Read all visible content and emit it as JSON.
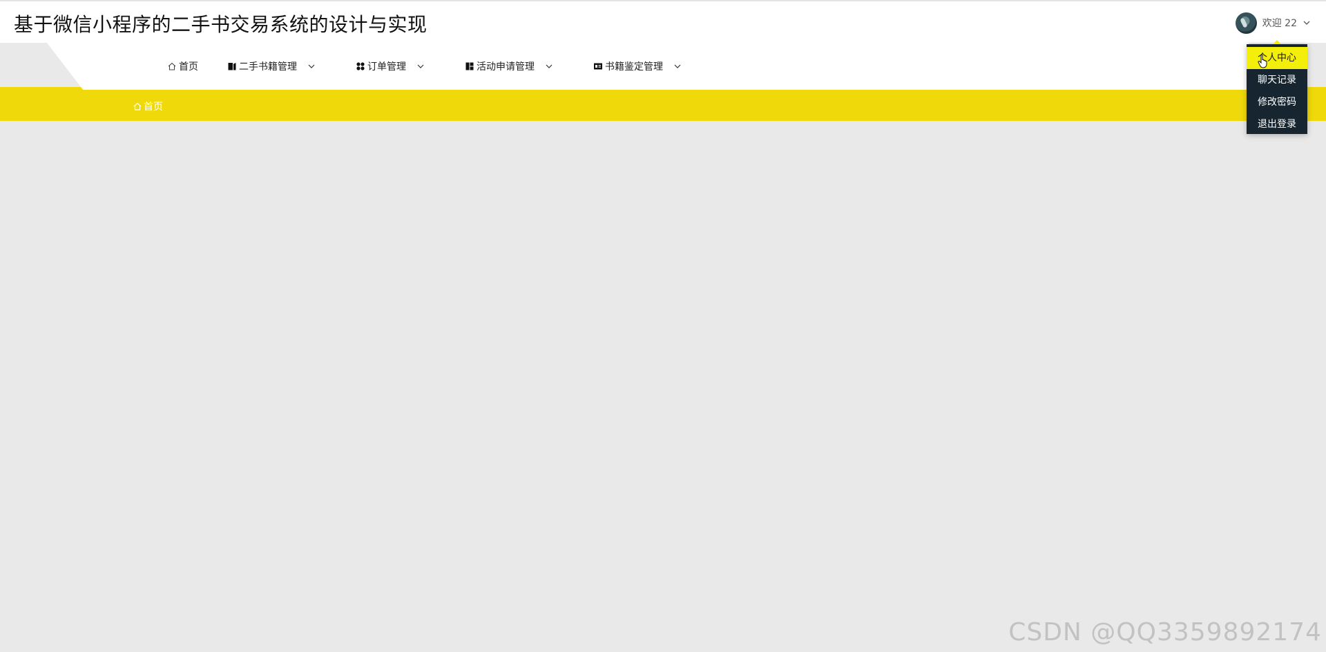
{
  "header": {
    "title": "基于微信小程序的二手书交易系统的设计与实现",
    "welcome": "欢迎 22"
  },
  "nav": {
    "items": [
      {
        "label": "首页",
        "icon": "home-icon"
      },
      {
        "label": "二手书籍管理",
        "icon": "book-icon"
      },
      {
        "label": "订单管理",
        "icon": "grid-icon"
      },
      {
        "label": "活动申请管理",
        "icon": "layout-icon"
      },
      {
        "label": "书籍鉴定管理",
        "icon": "id-card-icon"
      }
    ]
  },
  "breadcrumb": {
    "label": "首页",
    "icon": "home-icon"
  },
  "user_menu": {
    "items": [
      {
        "label": "个人中心",
        "state": "hovered"
      },
      {
        "label": "聊天记录"
      },
      {
        "label": "修改密码"
      },
      {
        "label": "退出登录"
      }
    ]
  },
  "watermark": "CSDN @QQ3359892174",
  "colors": {
    "accent_yellow": "#efd90a",
    "menu_highlight": "#f4ef0a",
    "dropdown_bg": "#16252f",
    "page_bg": "#e9e9e9"
  }
}
